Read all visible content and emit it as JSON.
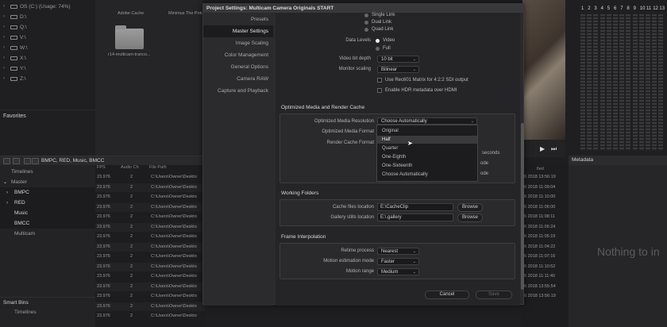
{
  "drives": [
    {
      "label": "OS (C:) (Usage: 74%)"
    },
    {
      "label": "D:\\"
    },
    {
      "label": "Q:\\"
    },
    {
      "label": "V:\\"
    },
    {
      "label": "W:\\"
    },
    {
      "label": "X:\\"
    },
    {
      "label": "Y:\\"
    },
    {
      "label": "Z:\\"
    }
  ],
  "favorites": {
    "title": "Favorites"
  },
  "media_folders": [
    {
      "label": "Adobe Cache"
    },
    {
      "label": "Minimus The Pok"
    },
    {
      "label": "r14-multicam-tranco..."
    }
  ],
  "pool_toolbar": {
    "path": "BMPC, RED, Music, BMCC"
  },
  "bins": [
    {
      "label": "Timelines"
    },
    {
      "label": "Master"
    },
    {
      "label": "BMPC"
    },
    {
      "label": "RED"
    },
    {
      "label": "Music"
    },
    {
      "label": "BMCC"
    },
    {
      "label": "Multicam"
    }
  ],
  "smart_bins": {
    "title": "Smart Bins",
    "item": "Timelines"
  },
  "table": {
    "headers": {
      "fps": "FPS",
      "audio": "Audio Ch",
      "path": "File Path"
    },
    "rows": [
      {
        "fps": "23.976",
        "audio": "2",
        "path": "C:\\Users\\Owner\\Deskto"
      },
      {
        "fps": "23.976",
        "audio": "2",
        "path": "C:\\Users\\Owner\\Deskto"
      },
      {
        "fps": "23.976",
        "audio": "2",
        "path": "C:\\Users\\Owner\\Deskto"
      },
      {
        "fps": "23.976",
        "audio": "2",
        "path": "C:\\Users\\Owner\\Deskto"
      },
      {
        "fps": "23.976",
        "audio": "2",
        "path": "C:\\Users\\Owner\\Deskto"
      },
      {
        "fps": "23.976",
        "audio": "2",
        "path": "C:\\Users\\Owner\\Deskto"
      },
      {
        "fps": "23.976",
        "audio": "2",
        "path": "C:\\Users\\Owner\\Deskto"
      },
      {
        "fps": "23.976",
        "audio": "2",
        "path": "C:\\Users\\Owner\\Deskto"
      },
      {
        "fps": "23.976",
        "audio": "2",
        "path": "C:\\Users\\Owner\\Deskto"
      },
      {
        "fps": "23.976",
        "audio": "2",
        "path": "C:\\Users\\Owner\\Deskto"
      },
      {
        "fps": "23.976",
        "audio": "2",
        "path": "C:\\Users\\Owner\\Deskto"
      },
      {
        "fps": "23.976",
        "audio": "2",
        "path": "C:\\Users\\Owner\\Deskto"
      },
      {
        "fps": "23.976",
        "audio": "2",
        "path": "C:\\Users\\Owner\\Deskto"
      },
      {
        "fps": "23.976",
        "audio": "2",
        "path": "C:\\Users\\Owner\\Deskto"
      },
      {
        "fps": "23.976",
        "audio": "2",
        "path": "C:\\Users\\Owner\\Deskto"
      }
    ]
  },
  "date_column": {
    "header": "fied",
    "rows": [
      "6 2018 13:56:19",
      "6 2018 11:09:04",
      "6 2018 11:10:00",
      "6 2018 11:06:00",
      "6 2018 11:08:11",
      "6 2018 11:06:24",
      "6 2018 11:05:19",
      "6 2018 11:04:22",
      "6 2018 11:07:16",
      "6 2018 11:10:52",
      "6 2018 11:11:40",
      "6 2018 13:55:54",
      "6 2018 13:56:19"
    ]
  },
  "meter": {
    "channels": [
      "1",
      "2",
      "3",
      "4",
      "5",
      "6",
      "7",
      "8",
      "9",
      "10",
      "11",
      "12",
      "13"
    ]
  },
  "metadata": {
    "title": "Metadata",
    "empty_text": "Nothing to in"
  },
  "dialog": {
    "title": "Project Settings:  Multicam Camera Originals START",
    "nav": [
      {
        "label": "Presets"
      },
      {
        "label": "Master Settings"
      },
      {
        "label": "Image Scaling"
      },
      {
        "label": "Color Management"
      },
      {
        "label": "General Options"
      },
      {
        "label": "Camera RAW"
      },
      {
        "label": "Capture and Playback"
      }
    ],
    "sdi": {
      "options": [
        "Single Link",
        "Dual Link",
        "Quad Link"
      ],
      "data_levels_label": "Data Levels",
      "data_levels": [
        "Video",
        "Full"
      ],
      "bit_depth_label": "Video bit depth",
      "bit_depth_value": "10 bit",
      "monitor_scaling_label": "Monitor scaling",
      "monitor_scaling_value": "Bilinear",
      "rec601_label": "Use Rec601 Matrix for 4:2:2 SDI output",
      "hdr_label": "Enable HDR metadata over HDMI"
    },
    "optimized": {
      "section": "Optimized Media and Render Cache",
      "resolution_label": "Optimized Media Resolution",
      "resolution_value": "Choose Automatically",
      "format_label": "Optimized Media Format",
      "cache_format_label": "Render Cache Format",
      "partial_seconds": "seconds",
      "partial_mode1": "ode",
      "partial_mode2": "ode",
      "options": [
        "Original",
        "Half",
        "Quarter",
        "One-Eighth",
        "One-Sixteenth",
        "Choose Automatically"
      ]
    },
    "working": {
      "section": "Working Folders",
      "cache_label": "Cache files location",
      "cache_value": "E:\\CacheClip",
      "gallery_label": "Gallery stills location",
      "gallery_value": "E:\\.gallery",
      "browse": "Browse"
    },
    "interp": {
      "section": "Frame Interpolation",
      "retime_label": "Retime process",
      "retime_value": "Nearest",
      "motion_mode_label": "Motion estimation mode",
      "motion_mode_value": "Faster",
      "motion_range_label": "Motion range",
      "motion_range_value": "Medium"
    },
    "cancel": "Cancel",
    "save": "Save"
  }
}
